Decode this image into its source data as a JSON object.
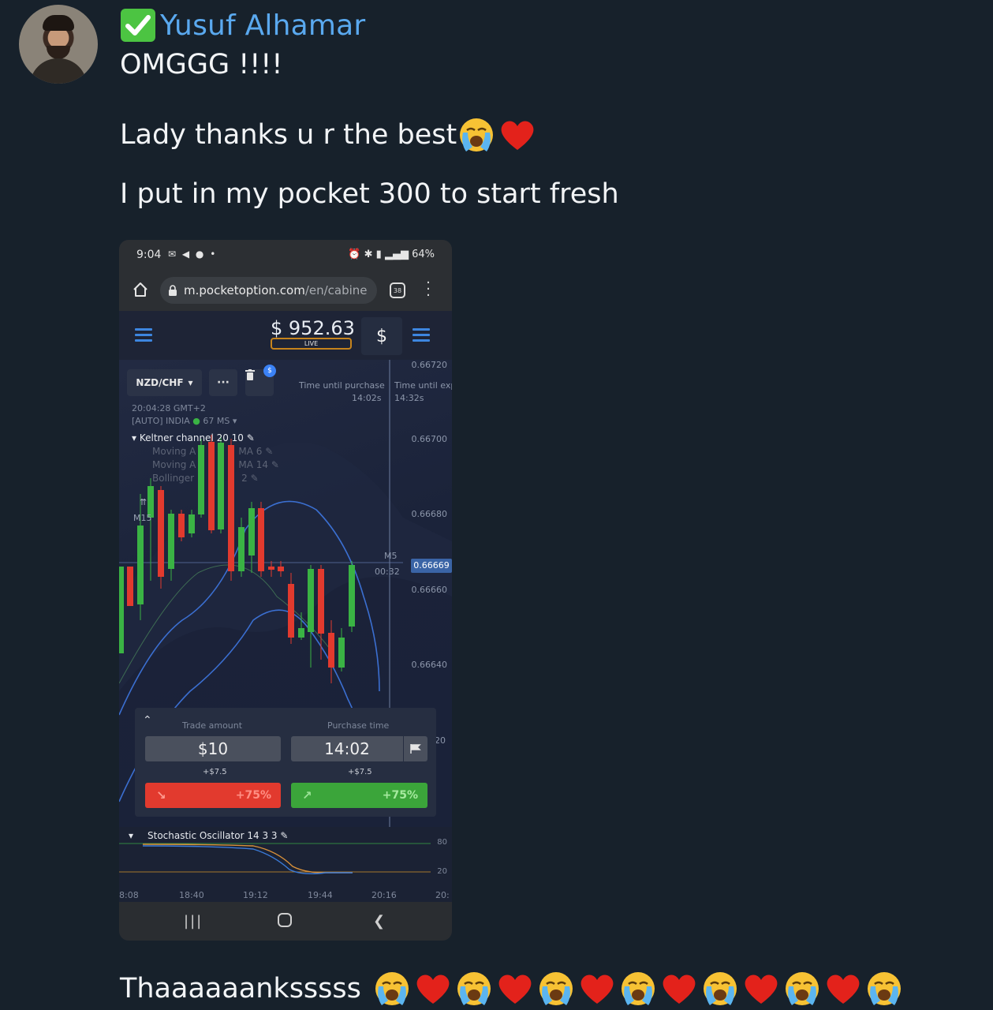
{
  "message": {
    "sender": "Yusuf Alhamar",
    "line1": "OMGGG !!!!",
    "line2": "Lady thanks u r the best",
    "line3": "I put in my pocket 300 to start fresh",
    "line4": "Thaaaaaanksssss"
  },
  "screenshot": {
    "status_bar": {
      "time": "9:04",
      "battery": "64%"
    },
    "browser": {
      "url_host": "m.pocketoption.com",
      "url_path": "/en/cabine",
      "tab_count": "38"
    },
    "app": {
      "balance": "$ 952.63",
      "account_mode": "LIVE",
      "currency_button": "$",
      "asset": "NZD/CHF",
      "server_time": "20:04:28 GMT+2",
      "connection": "[AUTO] INDIA",
      "ping": "67 MS",
      "time_until_purchase_label": "Time until purchase",
      "time_until_purchase": "14:02s",
      "time_until_expiry_label": "Time until exp",
      "time_until_expiry": "14:32s",
      "indicators": [
        "Keltner channel 20 10",
        "Moving A",
        "MA 6",
        "Moving A",
        "MA 14",
        "Bollinger",
        "2"
      ],
      "timeframe": "M15",
      "candle_timeframe": "M5",
      "candle_countdown": "00:32",
      "price_ticks": [
        "0.66720",
        "0.66700",
        "0.66680",
        "0.66660",
        "0.66640"
      ],
      "current_price": "0.66669",
      "trade": {
        "amount_label": "Trade amount",
        "amount": "$10",
        "time_label": "Purchase time",
        "time": "14:02",
        "payout_down": "+$7.5",
        "payout_up": "+$7.5",
        "down_percent": "+75%",
        "up_percent": "+75%"
      },
      "oscillator": {
        "label": "Stochastic Oscillator 14 3 3",
        "levels": [
          "80",
          "20"
        ],
        "side_tick": "20"
      },
      "time_axis": [
        "8:08",
        "18:40",
        "19:12",
        "19:44",
        "20:16",
        "20:"
      ]
    }
  }
}
